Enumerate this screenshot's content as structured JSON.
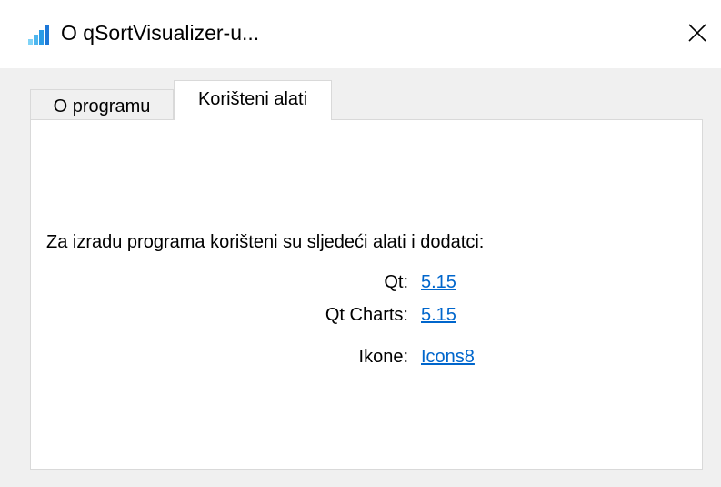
{
  "window": {
    "title": "O qSortVisualizer-u...",
    "app_icon": "bar-chart-icon",
    "close_icon": "close-icon",
    "close_glyph": "✕"
  },
  "tabs": [
    {
      "label": "O programu",
      "active": false
    },
    {
      "label": "Korišteni alati",
      "active": true
    }
  ],
  "content": {
    "intro": "Za izradu programa korišteni su sljedeći alati i dodatci:",
    "rows": [
      {
        "label": "Qt:",
        "link": "5.15"
      },
      {
        "label": "Qt Charts:",
        "link": "5.15"
      },
      {
        "label": "Ikone:",
        "link": "Icons8"
      }
    ]
  },
  "colors": {
    "link": "#0066cc",
    "icon_light": "#7fd3f7",
    "icon_dark": "#1e88e5"
  }
}
